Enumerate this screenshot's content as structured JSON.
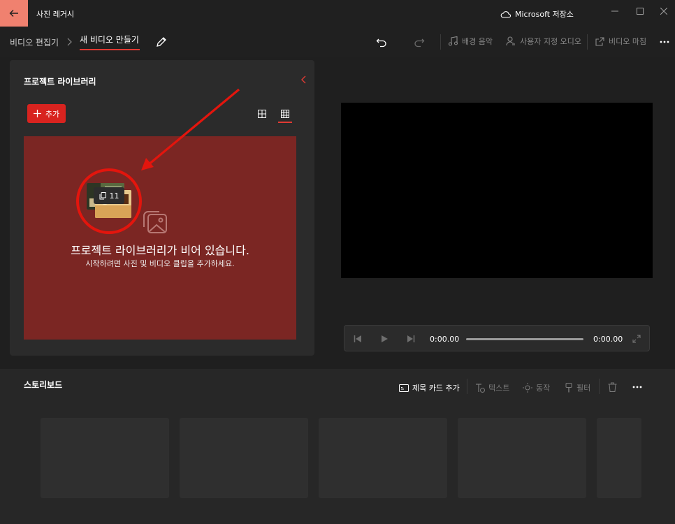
{
  "titlebar": {
    "title": "사진 레거시",
    "store_label": "Microsoft 저장소",
    "accent": "#f0816f"
  },
  "breadcrumb": {
    "parent": "비디오 편집기",
    "current": "새 비디오 만들기"
  },
  "toolbar": {
    "background_music": "배경 음악",
    "custom_audio": "사용자 지정 오디오",
    "finish_video": "비디오 마침"
  },
  "library": {
    "title": "프로젝트 라이브러리",
    "add_label": "추가",
    "empty_title": "프로젝트 라이브러리가 비어 있습니다.",
    "empty_subtitle": "시작하려면 사진 및 비디오 클립을 추가하세요.",
    "drag_count": "11",
    "dropzone_color": "#7b2623"
  },
  "player": {
    "current_time": "0:00.00",
    "total_time": "0:00.00",
    "progress": 0
  },
  "storyboard": {
    "title": "스토리보드",
    "add_title_card": "제목 카드 추가",
    "text": "텍스트",
    "motion": "동작",
    "filter": "필터"
  },
  "colors": {
    "accent_red": "#d8231f",
    "annotation_red": "#e3150d"
  }
}
